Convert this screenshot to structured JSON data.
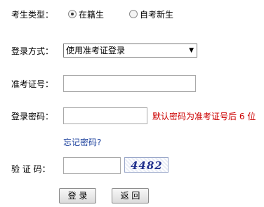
{
  "form": {
    "type_label": "考生类型：",
    "radio_options": [
      {
        "label": "在籍生",
        "selected": true
      },
      {
        "label": "自考新生",
        "selected": false
      }
    ],
    "login_method_label": "登录方式：",
    "login_method_value": "使用准考证登录",
    "ticket_label": "准考证号：",
    "ticket_value": "",
    "password_label": "登录密码：",
    "password_value": "",
    "password_hint": "默认密码为准考证号后 6 位",
    "forgot_password": "忘记密码?",
    "captcha_label": "验 证 码：",
    "captcha_value": "",
    "captcha_text": "4482",
    "login_button": "登 录",
    "back_button": "返 回"
  }
}
